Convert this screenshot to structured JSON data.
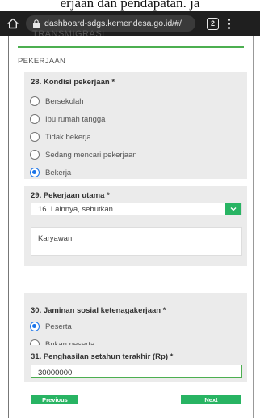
{
  "caption": {
    "text": "erjaan dan pendapatan. ja"
  },
  "browser": {
    "url": "dashboard-sdgs.kemendesa.go.id/#/",
    "tab_count": "2",
    "icons": [
      "home-icon",
      "lock-icon",
      "tabs-icon",
      "more-vert-icon"
    ]
  },
  "form": {
    "clipped_heading": "TRANSMIGRASI",
    "section_label": "PEKERJAAN",
    "q28": {
      "title": "28. Kondisi pekerjaan *",
      "options": [
        {
          "label": "Bersekolah",
          "checked": false
        },
        {
          "label": "Ibu rumah tangga",
          "checked": false
        },
        {
          "label": "Tidak bekerja",
          "checked": false
        },
        {
          "label": "Sedang mencari pekerjaan",
          "checked": false
        },
        {
          "label": "Bekerja",
          "checked": true
        }
      ]
    },
    "q29": {
      "title": "29. Pekerjaan utama *",
      "selected": "16. Lainnya, sebutkan",
      "other_text": "Karyawan"
    },
    "q30": {
      "title": "30. Jaminan sosial ketenagakerjaan *",
      "options": [
        {
          "label": "Peserta",
          "checked": true
        },
        {
          "label": "Bukan peserta",
          "checked": false
        }
      ]
    },
    "q31": {
      "title": "31. Penghasilan setahun terakhir (Rp) *",
      "value": "30000000"
    },
    "buttons": {
      "previous": "Previous",
      "next": "Next"
    }
  },
  "colors": {
    "accent_green": "#28b463",
    "radio_blue": "#1a73e8",
    "chrome_dark": "#1f1f1f"
  }
}
